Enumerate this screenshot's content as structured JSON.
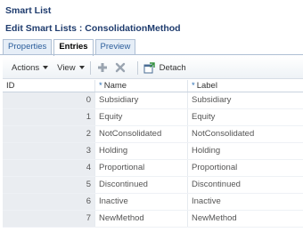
{
  "header": {
    "title": "Smart List",
    "subtitle": "Edit Smart Lists : ConsolidationMethod"
  },
  "tabs": [
    {
      "label": "Properties"
    },
    {
      "label": "Entries"
    },
    {
      "label": "Preview"
    }
  ],
  "toolbar": {
    "actions_label": "Actions",
    "view_label": "View",
    "detach_label": "Detach"
  },
  "table": {
    "required_marker": "*",
    "columns": [
      "ID",
      "Name",
      "Label"
    ],
    "rows": [
      {
        "id": "0",
        "name": "Subsidiary",
        "label": "Subsidiary"
      },
      {
        "id": "1",
        "name": "Equity",
        "label": "Equity"
      },
      {
        "id": "2",
        "name": "NotConsolidated",
        "label": "NotConsolidated"
      },
      {
        "id": "3",
        "name": "Holding",
        "label": "Holding"
      },
      {
        "id": "4",
        "name": "Proportional",
        "label": "Proportional"
      },
      {
        "id": "5",
        "name": "Discontinued",
        "label": "Discontinued"
      },
      {
        "id": "6",
        "name": "Inactive",
        "label": "Inactive"
      },
      {
        "id": "7",
        "name": "NewMethod",
        "label": "NewMethod"
      }
    ]
  },
  "colors": {
    "title": "#1f3c6e",
    "tab_text": "#2b5d9b",
    "required_marker": "#2a6fb4",
    "id_cell_bg": "#eaedf1"
  },
  "icons": [
    "plus-icon",
    "delete-x-icon",
    "detach-icon"
  ]
}
